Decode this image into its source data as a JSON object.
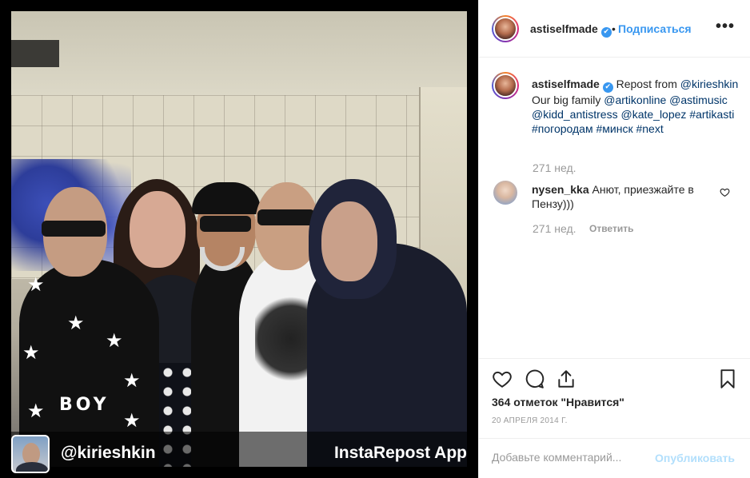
{
  "photo": {
    "shirt_text": "BOY",
    "watermark": {
      "handle": "@kirieshkin",
      "app_name": "InstaRepost App"
    }
  },
  "header": {
    "username": "astiselfmade",
    "verified_glyph": "✔",
    "separator": "•",
    "follow_label": "Подписаться",
    "more_label": "•••"
  },
  "caption": {
    "username": "astiselfmade",
    "lead_text": " Repost from ",
    "mention_source": "@kirieshkin",
    "body_text": " Our big family ",
    "mentions": [
      "@artikonline",
      "@astimusic",
      "@kidd_antistress",
      "@kate_lopez"
    ],
    "hashtags": [
      "#artikasti",
      "#погородам",
      "#минск",
      "#next"
    ],
    "time": "271 нед."
  },
  "comments": [
    {
      "username": "nysen_kka",
      "text": " Анют, приезжайте в Пензу)))",
      "time": "271 нед.",
      "reply_label": "Ответить"
    }
  ],
  "actions": {
    "icons": [
      "heart-icon",
      "comment-icon",
      "share-icon",
      "bookmark-icon"
    ],
    "likes_text": "364 отметок \"Нравится\"",
    "date_text": "20 АПРЕЛЯ 2014 Г."
  },
  "comment_bar": {
    "placeholder": "Добавьте комментарий...",
    "publish_label": "Опубликовать"
  },
  "colors": {
    "link": "#003569",
    "accent": "#3897f0",
    "muted": "#999999",
    "publish_disabled": "#b2dffc"
  }
}
